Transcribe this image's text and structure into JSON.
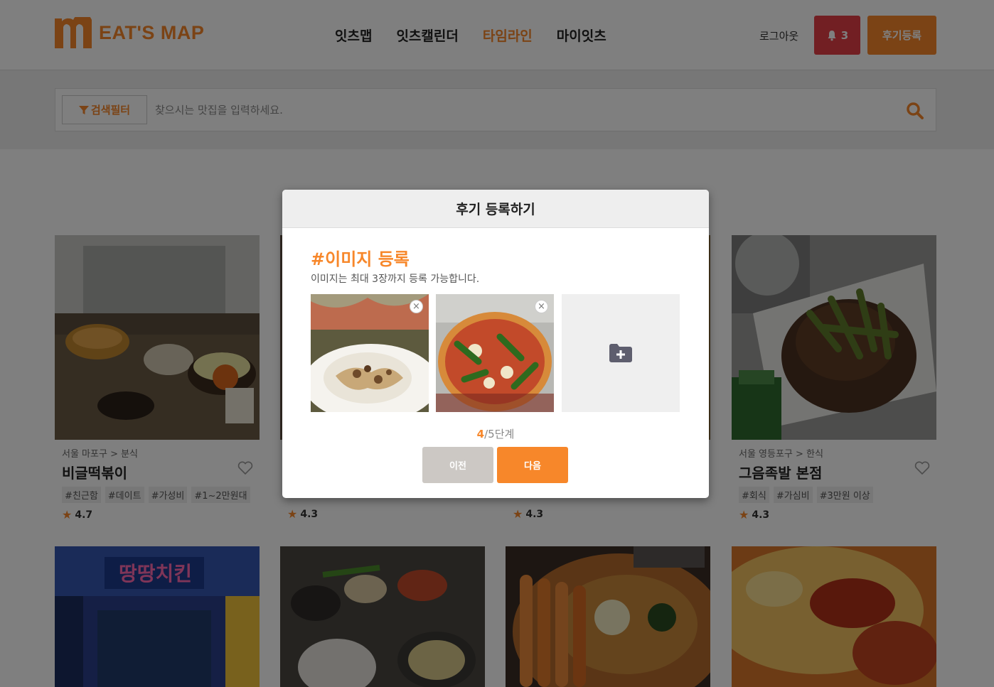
{
  "header": {
    "logo_text": "EAT'S MAP",
    "nav": [
      "잇츠맵",
      "잇츠캘린더",
      "타임라인",
      "마이잇츠"
    ],
    "active_nav": "타임라인",
    "logout": "로그아웃",
    "notification_count": "3",
    "review_button": "후기등록"
  },
  "search": {
    "filter_label": "검색필터",
    "placeholder": "찾으시는 맛집을 입력하세요."
  },
  "section": {
    "title_prefix": "",
    "title_highlight": "",
    "title_suffix": ""
  },
  "cards_row1": [
    {
      "location": "서울 마포구 > 분식",
      "name": "비글떡볶이",
      "tags": [
        "#친근함",
        "#데이트",
        "#가성비",
        "#1~2만원대"
      ],
      "rating": "4.7"
    },
    {
      "location": "",
      "name": "",
      "tags": [],
      "rating": "4.3"
    },
    {
      "location": "",
      "name": "",
      "tags": [],
      "rating": "4.3"
    },
    {
      "location": "서울 영등포구 > 한식",
      "name": "그음족발 본점",
      "tags": [
        "#회식",
        "#가심비",
        "#3만원 이상"
      ],
      "rating": "4.3"
    }
  ],
  "modal": {
    "title": "후기 등록하기",
    "step_title": "#이미지 등록",
    "step_desc": "이미지는 최대 3장까지 등록 가능합니다.",
    "step_current": "4",
    "step_rest": "/5단계",
    "prev_label": "이전",
    "next_label": "다음",
    "close_glyph": "×"
  },
  "colors": {
    "accent": "#f7872a",
    "alert": "#e53e46",
    "prev_button": "#ccc8c4"
  }
}
